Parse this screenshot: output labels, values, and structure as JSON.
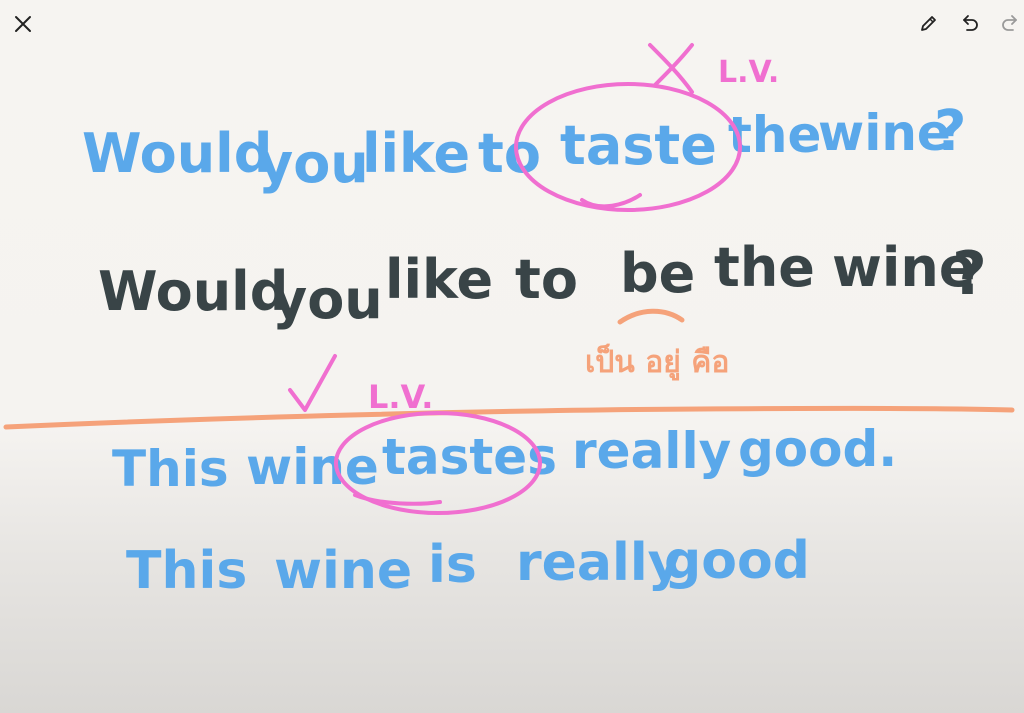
{
  "toolbar": {
    "close_icon": "close-icon",
    "pen_icon": "pen-icon",
    "undo_icon": "undo-icon",
    "redo_icon": "redo-icon"
  },
  "whiteboard": {
    "line1": {
      "words": [
        "Would",
        "you",
        "like",
        "to",
        "taste",
        "the",
        "wine",
        "?"
      ]
    },
    "line1_mark": "X L.V.",
    "line2": {
      "words": [
        "Would",
        "you",
        "like",
        "to",
        "be",
        "the",
        "wine",
        "?"
      ]
    },
    "thai_note": "เป็น อยู่ คือ",
    "line3_mark": "✓ L.V.",
    "line3": {
      "words": [
        "This",
        "wine",
        "tastes",
        "really",
        "good."
      ]
    },
    "line4": {
      "words": [
        "This",
        "wine",
        "is",
        "really",
        "good"
      ]
    }
  },
  "colors": {
    "blue_ink": "#5aa8ea",
    "dark_ink": "#394447",
    "pink_ink": "#f06fd0",
    "orange_ink": "#f5a27a"
  }
}
